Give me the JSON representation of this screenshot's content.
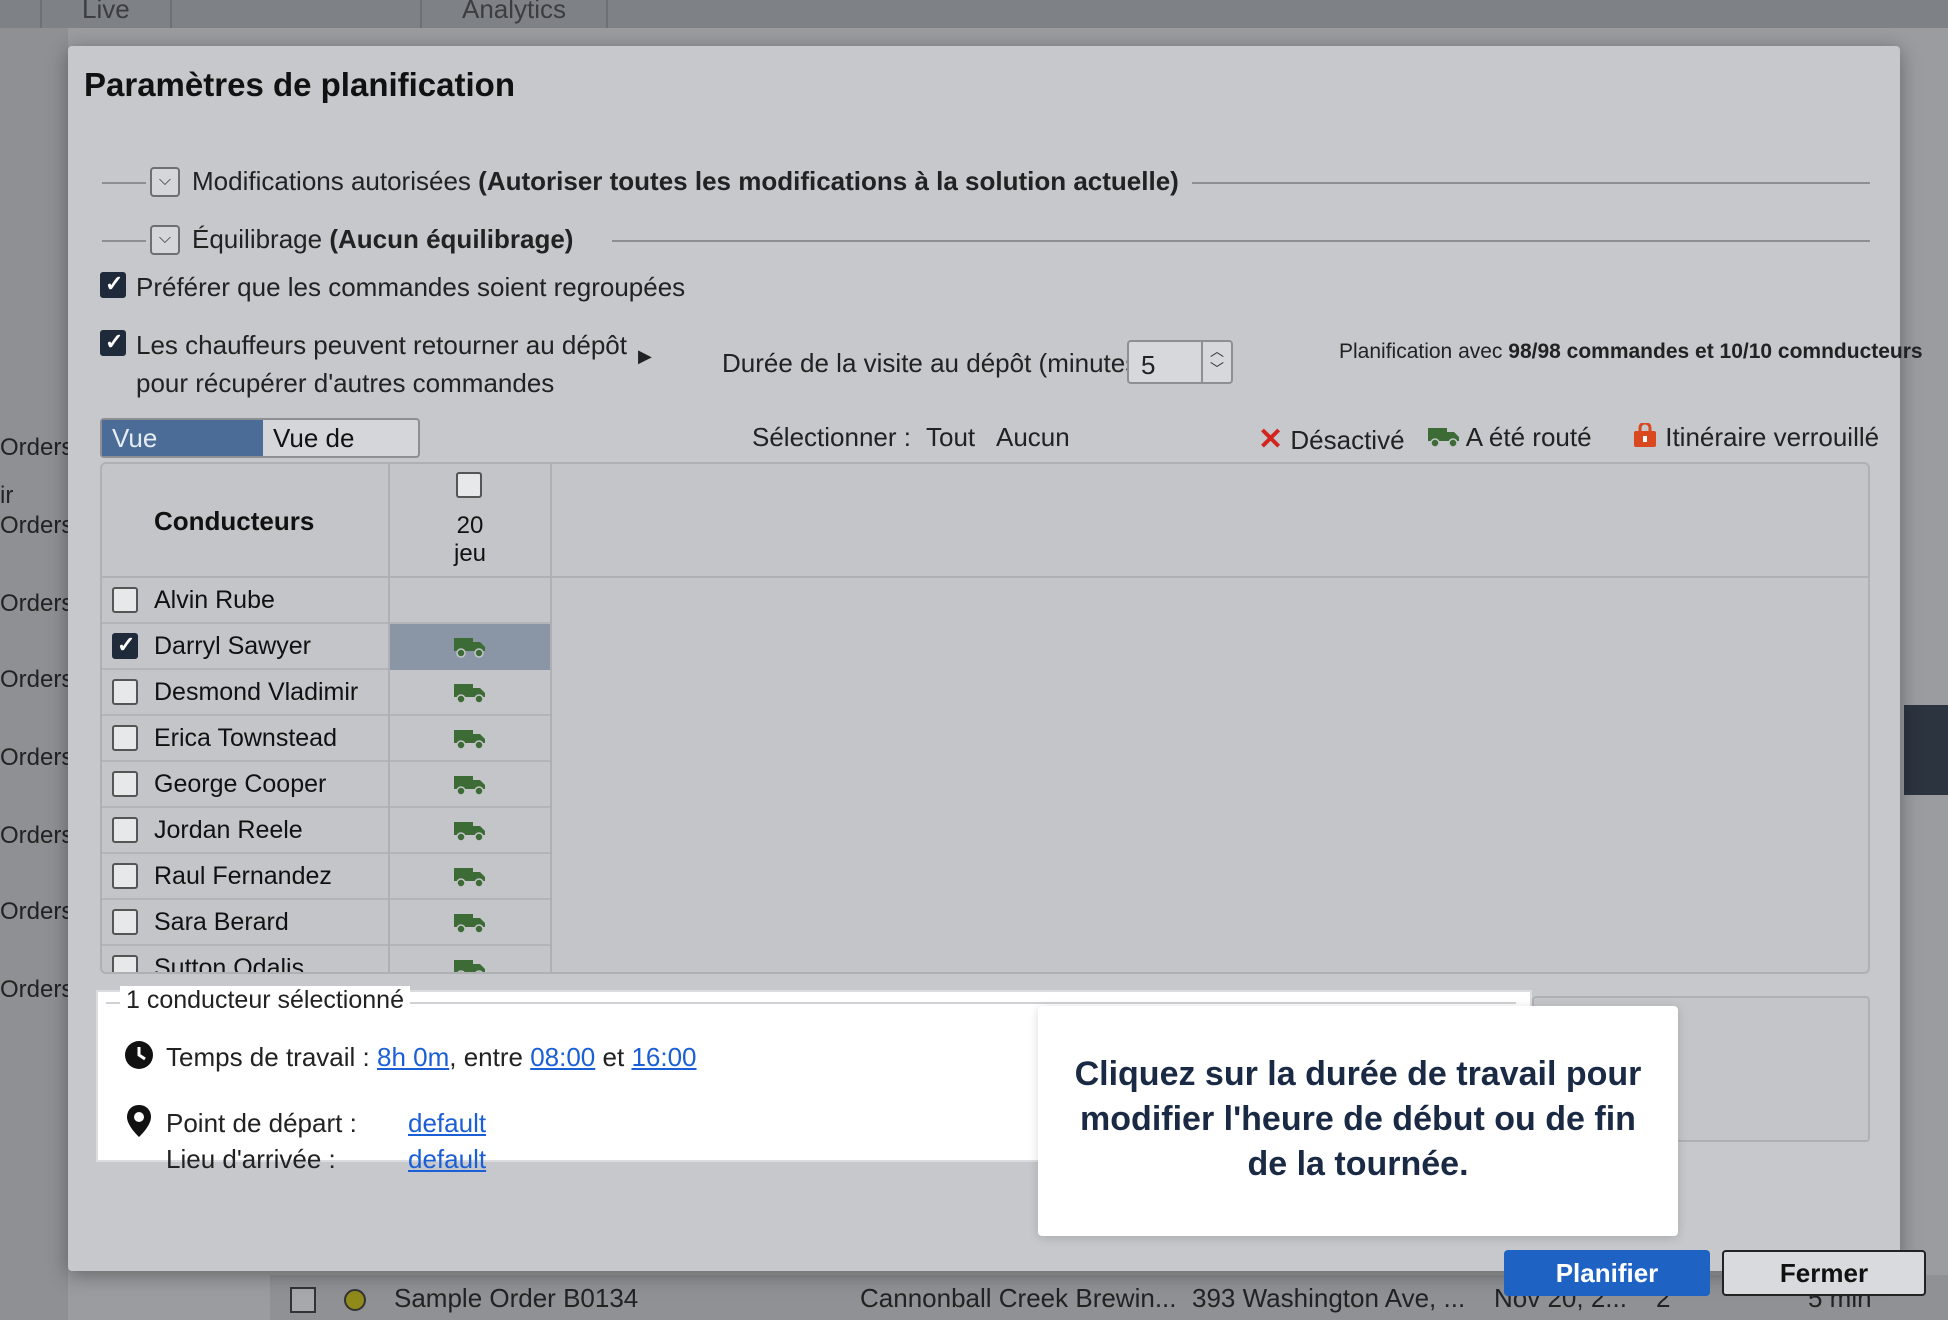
{
  "background": {
    "tabs": [
      "Live",
      "Analytics"
    ],
    "left_labels": [
      "Orders:",
      "ir",
      "Orders:",
      "Orders:",
      "Orders:",
      "Orders:",
      "Orders:",
      "Orders:",
      "Orders:"
    ],
    "order_row": {
      "name": "Sample Order B0134",
      "customer": "Cannonball Creek Brewin...",
      "address": "393 Washington Ave, ...",
      "date": "Nov 20, 2...",
      "count": "2",
      "duration": "5 min"
    }
  },
  "modal": {
    "title": "Paramètres de planification",
    "sections": [
      {
        "label": "Modifications autorisées",
        "value": "(Autoriser toutes les modifications à la solution actuelle)"
      },
      {
        "label": "Équilibrage",
        "value": "(Aucun équilibrage)"
      }
    ],
    "options": {
      "group_orders": {
        "label": "Préférer que les commandes soient regroupées",
        "checked": true
      },
      "return_depot": {
        "label_line1": "Les chauffeurs peuvent retourner au dépôt",
        "label_line2": "pour récupérer d'autres commandes",
        "checked": true
      }
    },
    "depot_visit": {
      "label": "Durée de la visite au dépôt (minutes) :",
      "value": "5"
    },
    "planning_summary": {
      "prefix": "Planification avec ",
      "bold": "98/98 commandes et 10/10 comnducteurs"
    },
    "view_toggle": {
      "active": "Vue avancée",
      "inactive": "Vue de base"
    },
    "select": {
      "label": "Sélectionner :",
      "all": "Tout",
      "none": "Aucun"
    },
    "legend": {
      "disabled": "Désactivé",
      "routed": "A été routé",
      "locked": "Itinéraire verrouillé"
    },
    "grid": {
      "drivers_header": "Conducteurs",
      "day_number": "20",
      "day_name": "jeu",
      "drivers": [
        {
          "name": "Alvin Rube",
          "checked": false,
          "routed": false,
          "selected": false
        },
        {
          "name": "Darryl Sawyer",
          "checked": true,
          "routed": true,
          "selected": true
        },
        {
          "name": "Desmond Vladimir",
          "checked": false,
          "routed": true,
          "selected": false
        },
        {
          "name": "Erica Townstead",
          "checked": false,
          "routed": true,
          "selected": false
        },
        {
          "name": "George Cooper",
          "checked": false,
          "routed": true,
          "selected": false
        },
        {
          "name": "Jordan Reele",
          "checked": false,
          "routed": true,
          "selected": false
        },
        {
          "name": "Raul Fernandez",
          "checked": false,
          "routed": true,
          "selected": false
        },
        {
          "name": "Sara Berard",
          "checked": false,
          "routed": true,
          "selected": false
        },
        {
          "name": "Sutton Odalis",
          "checked": false,
          "routed": true,
          "selected": false
        }
      ]
    },
    "selection_panel": {
      "title": "1 conducteur sélectionné",
      "work_time_label": "Temps de travail :",
      "work_time_value": "8h 0m",
      "between": ", entre",
      "start": "08:00",
      "and": "et",
      "end": "16:00",
      "start_point_label": "Point de départ :",
      "start_point_value": "default",
      "end_point_label": "Lieu d'arrivée :",
      "end_point_value": "default"
    },
    "tooltip": "Cliquez sur la durée de travail pour modifier l'heure de début ou de fin de la tournée.",
    "buttons": {
      "plan": "Planifier",
      "close": "Fermer"
    }
  },
  "colors": {
    "accent": "#1e63c4",
    "truck": "#3d6b35",
    "disabled": "#d3241e",
    "lock": "#d9481f"
  }
}
